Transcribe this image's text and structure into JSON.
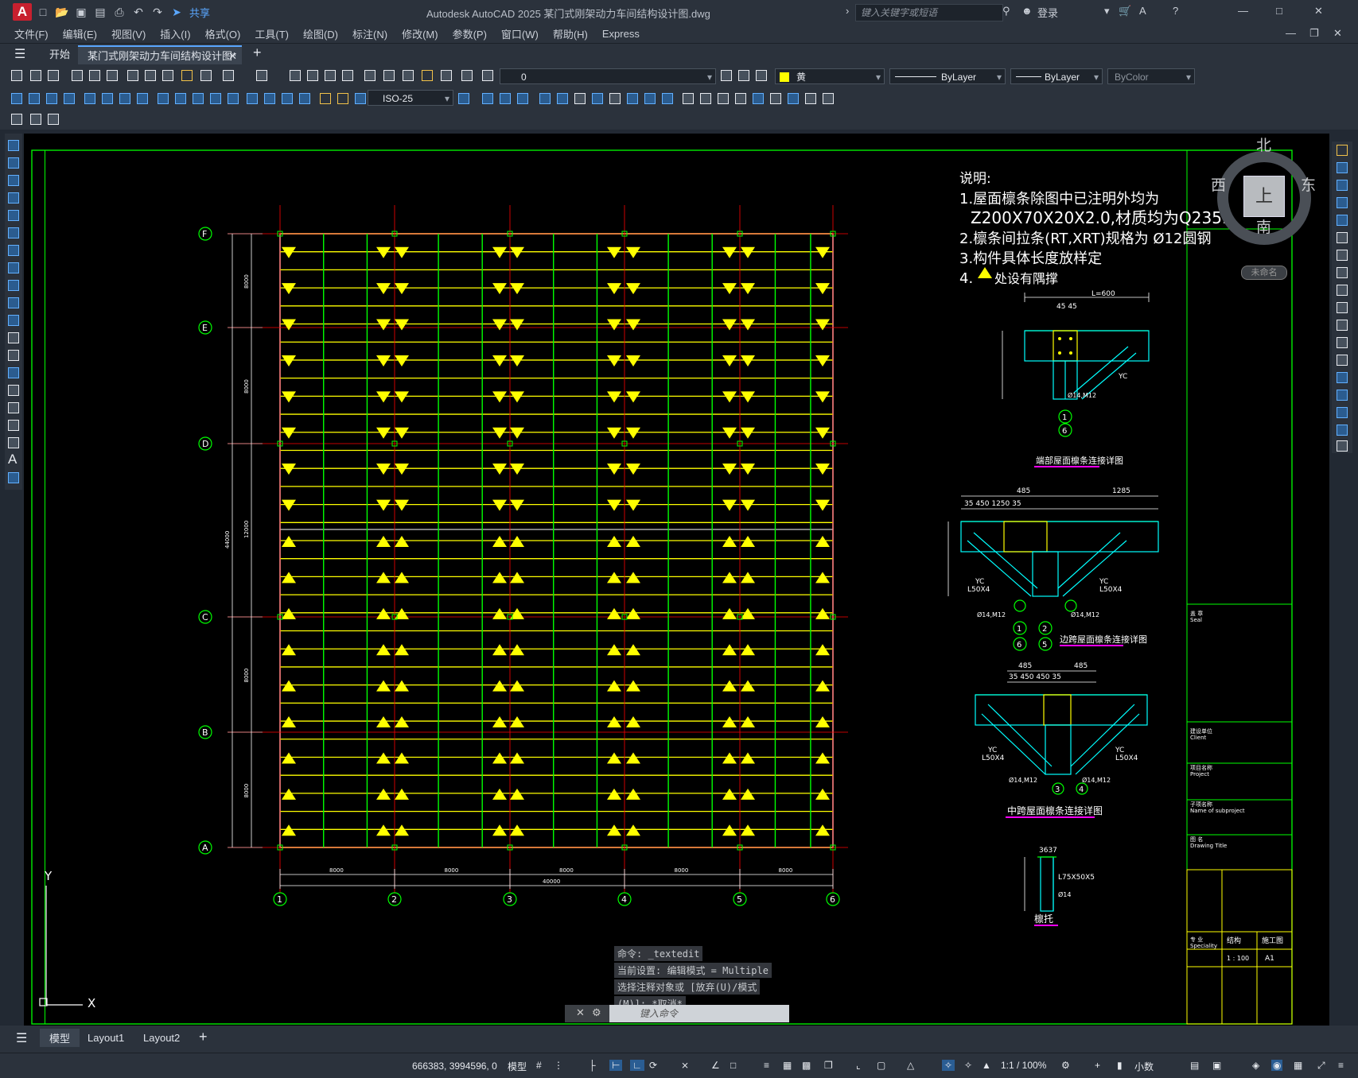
{
  "app": {
    "icon_letter": "A",
    "title": "Autodesk AutoCAD 2025    某门式刚架动力车间结构设计图.dwg",
    "share_label": "共享",
    "search_placeholder": "键入关键字或短语",
    "login_label": "登录"
  },
  "menu": [
    "文件(F)",
    "编辑(E)",
    "视图(V)",
    "插入(I)",
    "格式(O)",
    "工具(T)",
    "绘图(D)",
    "标注(N)",
    "修改(M)",
    "参数(P)",
    "窗口(W)",
    "帮助(H)",
    "Express"
  ],
  "tabs": {
    "start": "开始",
    "file": "某门式刚架动力车间结构设计图*"
  },
  "layer": {
    "name": "0",
    "color_name": "黄",
    "linetype": "ByLayer",
    "lineweight": "ByLayer",
    "plotstyle": "ByColor",
    "dimstyle": "ISO-25"
  },
  "colors": {
    "yellow": "#ffff00",
    "green": "#00ff00",
    "red": "#ff0000",
    "cyan": "#00ffff",
    "magenta": "#ff00ff"
  },
  "drawing": {
    "grid_rows": [
      "F",
      "E",
      "D",
      "C",
      "B",
      "A"
    ],
    "grid_cols": [
      "1",
      "2",
      "3",
      "4",
      "5",
      "6"
    ],
    "bay_spacing": [
      "8000",
      "8000",
      "8000",
      "8000",
      "8000"
    ],
    "total_length": "40000",
    "left_dims": [
      "8000",
      "8000",
      "12000",
      "8000",
      "8000"
    ],
    "left_total": "44000",
    "notes": {
      "title": "说明:",
      "line1": "1.屋面檩条除图中已注明外均为",
      "line2": "Z200X70X20X2.0,材质均为Q235.",
      "line3": "2.檩条间拉条(RT,XRT)规格为 Ø12圆钢",
      "line4": "3.构件具体长度放样定",
      "line5": "4.",
      "line5b": "处设有隅撑"
    },
    "details": {
      "d1_title": "端部屋面檩条连接详图",
      "d1_top": "L=600",
      "d1_dims": "45 45",
      "d1_marks": [
        "1",
        "6"
      ],
      "d2_title": "边跨屋面檩条连接详图",
      "d2_top1": "485",
      "d2_top2": "1285",
      "d2_sub": "35  450              1250             35",
      "d2_marks": [
        "1",
        "2",
        "6",
        "5"
      ],
      "d3_title": "中跨屋面檩条连接详图",
      "d3_top1": "485",
      "d3_top2": "485",
      "d3_sub": "35  450          450  35",
      "d3_marks": [
        "3",
        "4"
      ],
      "yc_label": "YC",
      "l50_label": "L50X4",
      "bolt_label": "Ø14,M12",
      "d4_title": "檩托",
      "d4_dims": "3637",
      "d4_label": "L75X50X5",
      "d4_bolt": "Ø14"
    },
    "titleblock": {
      "seal": "盖 章",
      "seal_en": "Seal",
      "client": "建设单位",
      "client_en": "Client",
      "project": "项目名称",
      "project_en": "Project",
      "subproject": "子项名称",
      "subproject_en": "Name of subproject",
      "drawing": "图 名",
      "drawing_en": "Drawing Title",
      "speciality": "专 业",
      "speciality_en": "Speciality",
      "spec_value": "结构",
      "status": "施工图",
      "scale": "1 : 100",
      "size": "A1"
    },
    "axes": {
      "y": "Y",
      "x": "X"
    }
  },
  "compass": {
    "n": "北",
    "s": "南",
    "w": "西",
    "e": "东",
    "top": "上",
    "wcs": "未命名"
  },
  "command": {
    "line1": "命令: _textedit",
    "line2": "当前设置: 编辑模式 = Multiple",
    "line3": "选择注释对象或 [放弃(U)/模式",
    "line4": "(M)]: *取消*",
    "input_placeholder": "键入命令"
  },
  "layouts": [
    "模型",
    "Layout1",
    "Layout2"
  ],
  "status": {
    "coords": "666383, 3994596, 0",
    "model": "模型",
    "scale": "1:1 / 100%",
    "units": "小数"
  }
}
